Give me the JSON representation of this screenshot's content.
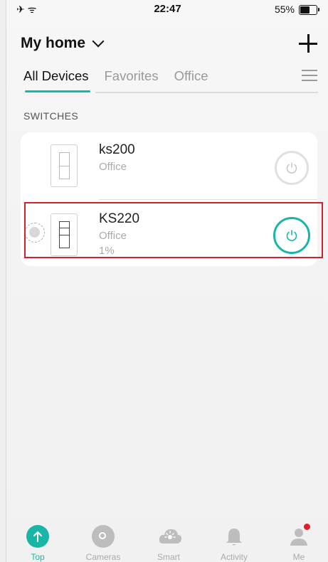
{
  "status_bar": {
    "time": "22:47",
    "battery": "55%",
    "battery_level": 0.55
  },
  "header": {
    "title": "My home"
  },
  "tabs": [
    {
      "label": "All Devices",
      "active": true
    },
    {
      "label": "Favorites",
      "active": false
    },
    {
      "label": "Office",
      "active": false
    }
  ],
  "section_title": "SWITCHES",
  "devices": [
    {
      "name": "ks200",
      "room": "Office",
      "level": "",
      "power": "off"
    },
    {
      "name": "KS220",
      "room": "Office",
      "level": "1%",
      "power": "on"
    }
  ],
  "nav": [
    {
      "label": "Top",
      "icon": "arrow-up-icon",
      "active": true
    },
    {
      "label": "Cameras",
      "icon": "camera-icon",
      "active": false
    },
    {
      "label": "Smart",
      "icon": "smart-cloud-icon",
      "active": false
    },
    {
      "label": "Activity",
      "icon": "bell-icon",
      "active": false
    },
    {
      "label": "Me",
      "icon": "person-icon",
      "active": false,
      "notification": true
    }
  ],
  "colors": {
    "accent": "#19b6a7",
    "highlight": "#d4202a",
    "notification": "#e8192c"
  }
}
